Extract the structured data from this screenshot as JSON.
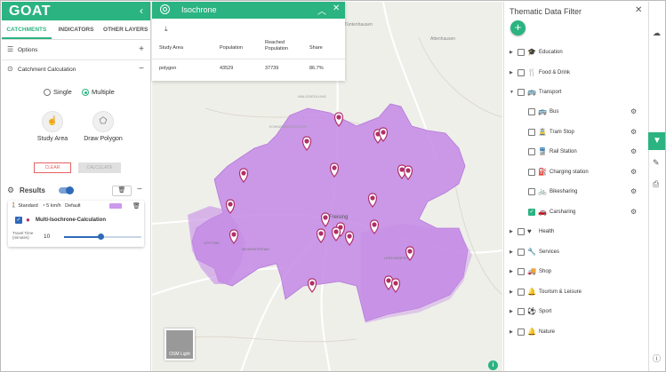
{
  "app": {
    "logo": "GOAT"
  },
  "left": {
    "tabs": [
      {
        "label": "CATCHMENTS",
        "active": true
      },
      {
        "label": "INDICATORS",
        "active": false
      },
      {
        "label": "OTHER LAYERS",
        "active": false
      }
    ],
    "options_label": "Options",
    "catchment_label": "Catchment Calculation",
    "mode_single": "Single",
    "mode_multiple": "Multiple",
    "study_area": "Study Area",
    "draw_polygon": "Draw Polygon",
    "clear": "CLEAR",
    "calculate": "CALCULATE",
    "results": "Results",
    "card": {
      "mode": "Standard",
      "speed": "5 km/h",
      "profile": "Default",
      "calc_name": "Multi-Isochrone-Calculation",
      "travel_time_label": "Travel Time (minutes)",
      "travel_time_value": "10",
      "travel_time_fraction": 0.48
    }
  },
  "iso": {
    "title": "Isochrone",
    "headers": [
      "Study Area",
      "Population",
      "Reached Population",
      "Share"
    ],
    "row": [
      "polygon",
      "43529",
      "37739",
      "86.7%"
    ]
  },
  "map": {
    "labels": [
      "Tüntenhausen",
      "Attenhausen",
      "WALDSIEDLUNG",
      "ECHINGERMUSSELDORF",
      "LERCHENFELD",
      "Freising",
      "VÖTTING",
      "WEIHENSTEPHAN"
    ],
    "tile_caption": "OSM Light",
    "info": "i",
    "isochrone_color": "#c58ce6"
  },
  "filter": {
    "title": "Thematic Data Filter",
    "groups": [
      {
        "name": "Education",
        "icon": "education-icon"
      },
      {
        "name": "Food & Drink",
        "icon": "food-icon"
      },
      {
        "name": "Transport",
        "icon": "transport-icon",
        "expanded": true
      },
      {
        "name": "Health",
        "icon": "health-icon"
      },
      {
        "name": "Services",
        "icon": "services-icon"
      },
      {
        "name": "Shop",
        "icon": "shop-icon"
      },
      {
        "name": "Tourism & Leisure",
        "icon": "tourism-icon"
      },
      {
        "name": "Sport",
        "icon": "sport-icon"
      },
      {
        "name": "Nature",
        "icon": "nature-icon"
      }
    ],
    "transport_items": [
      {
        "name": "Bus",
        "checked": false
      },
      {
        "name": "Tram Stop",
        "checked": false
      },
      {
        "name": "Rail Station",
        "checked": false
      },
      {
        "name": "Charging station",
        "checked": false
      },
      {
        "name": "Bikesharing",
        "checked": false
      },
      {
        "name": "Carsharing",
        "checked": true
      }
    ]
  },
  "colors": {
    "accent": "#2bb381",
    "isochrone": "#c58ce6",
    "marker": "#b0306a",
    "primary": "#2f69b8"
  }
}
